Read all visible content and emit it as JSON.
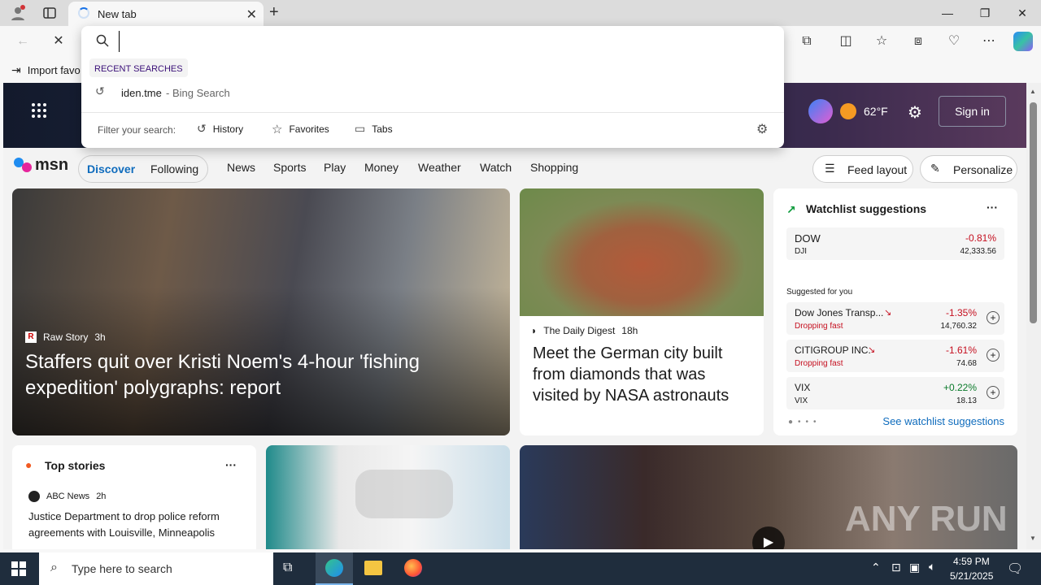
{
  "browser": {
    "tab_title": "New tab",
    "address_value": "",
    "win_minimize": "—",
    "win_restore": "❐",
    "win_close": "✕",
    "favorites_import": "Import favo"
  },
  "dropdown": {
    "recent_header": "RECENT SEARCHES",
    "recent_query": "iden.tme",
    "recent_suffix": " - Bing Search",
    "filter_label": "Filter your search:",
    "filter_history": "History",
    "filter_favorites": "Favorites",
    "filter_tabs": "Tabs"
  },
  "hero": {
    "temperature": "62°F",
    "sign_in": "Sign in"
  },
  "msn": {
    "logo": "msn",
    "tabs": [
      "Discover",
      "Following"
    ],
    "nav": [
      "News",
      "Sports",
      "Play",
      "Money",
      "Weather",
      "Watch",
      "Shopping"
    ],
    "feed_layout": "Feed layout",
    "personalize": "Personalize"
  },
  "main_story": {
    "source": "Raw Story",
    "age": "3h",
    "headline": "Staffers quit over Kristi Noem's 4-hour 'fishing expedition' polygraphs: report"
  },
  "second_story": {
    "source": "The Daily Digest",
    "age": "18h",
    "headline": "Meet the German city built from diamonds that was visited by NASA astronauts"
  },
  "watchlist": {
    "title": "Watchlist suggestions",
    "more": "···",
    "index": {
      "name": "DOW",
      "sub": "DJI",
      "change": "-0.81%",
      "value": "42,333.56"
    },
    "suggested_label": "Suggested for you",
    "items": [
      {
        "name": "Dow Jones Transp...",
        "status": "Dropping fast",
        "change": "-1.35%",
        "value": "14,760.32"
      },
      {
        "name": "CITIGROUP INC.",
        "status": "Dropping fast",
        "change": "-1.61%",
        "value": "74.68"
      },
      {
        "name": "VIX",
        "status": "VIX",
        "change": "+0.22%",
        "value": "18.13"
      }
    ],
    "see_link": "See watchlist suggestions"
  },
  "top_stories": {
    "title": "Top stories",
    "more": "···",
    "source": "ABC News",
    "age": "2h",
    "headline": "Justice Department to drop police reform agreements with Louisville, Minneapolis"
  },
  "watermark": "ANY RUN",
  "taskbar": {
    "search_placeholder": "Type here to search",
    "time": "4:59 PM",
    "date": "5/21/2025"
  },
  "colors": {
    "accent": "#0f6cbd",
    "down": "#c50f1f",
    "up": "#0a7a2a"
  }
}
